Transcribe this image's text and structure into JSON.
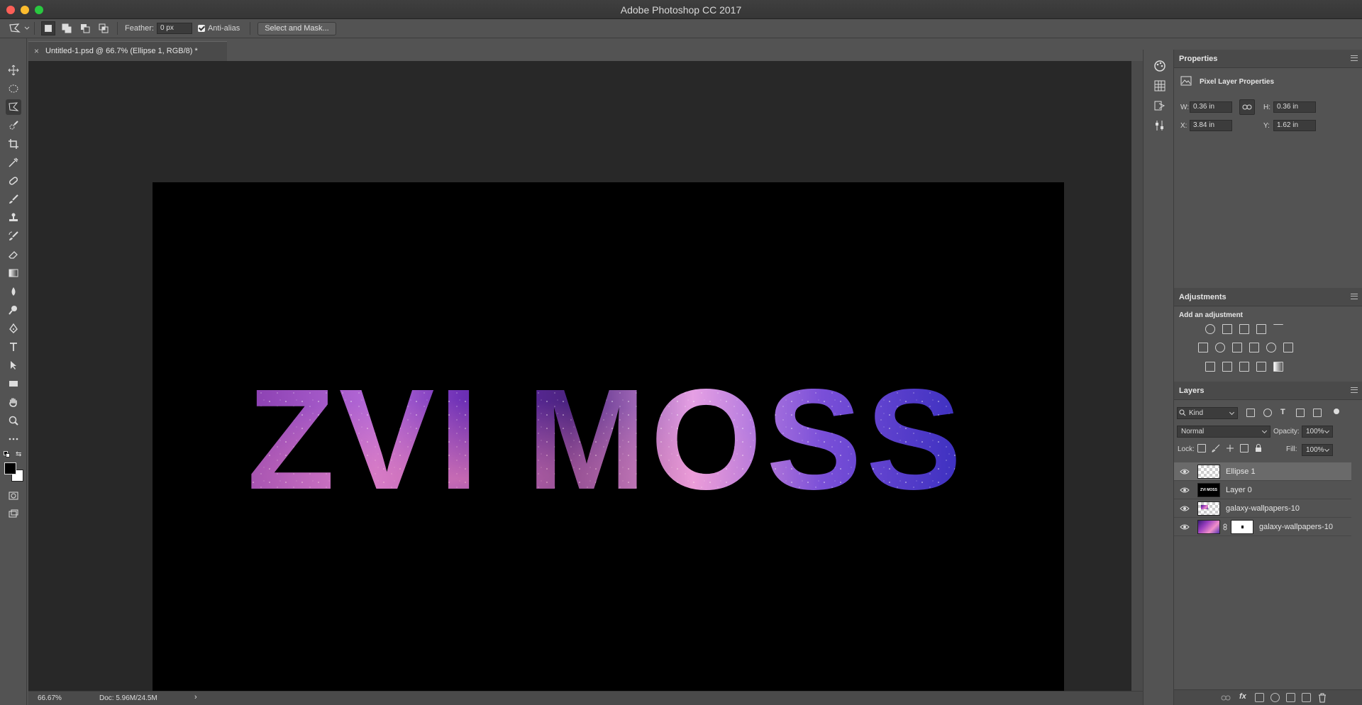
{
  "window": {
    "title": "Adobe Photoshop CC 2017"
  },
  "options_bar": {
    "feather_label": "Feather:",
    "feather_value": "0 px",
    "antialias_label": "Anti-alias",
    "antialias_checked": true,
    "select_mask_label": "Select and Mask..."
  },
  "document": {
    "tab_title": "Untitled-1.psd @ 66.7% (Ellipse 1, RGB/8) *",
    "canvas_text": "ZVI MOSS"
  },
  "status": {
    "zoom": "66.67%",
    "doc": "Doc: 5.96M/24.5M"
  },
  "properties": {
    "title": "Properties",
    "subtitle": "Pixel Layer Properties",
    "w_label": "W:",
    "w_value": "0.36 in",
    "h_label": "H:",
    "h_value": "0.36 in",
    "x_label": "X:",
    "x_value": "3.84 in",
    "y_label": "Y:",
    "y_value": "1.62 in"
  },
  "adjustments": {
    "title": "Adjustments",
    "subtitle": "Add an adjustment"
  },
  "layers": {
    "title": "Layers",
    "filter_label": "Kind",
    "blend_mode": "Normal",
    "opacity_label": "Opacity:",
    "opacity_value": "100%",
    "lock_label": "Lock:",
    "fill_label": "Fill:",
    "fill_value": "100%",
    "items": [
      {
        "name": "Ellipse 1"
      },
      {
        "name": "Layer 0",
        "thumb_text": "ZVI MOSS"
      },
      {
        "name": "galaxy-wallpapers-10"
      },
      {
        "name": "galaxy-wallpapers-10"
      }
    ]
  },
  "colors": {
    "accent_purple": "#7b3fc4",
    "traffic_red": "#fc5f57",
    "traffic_yellow": "#fdbc2e",
    "traffic_green": "#29c840"
  }
}
